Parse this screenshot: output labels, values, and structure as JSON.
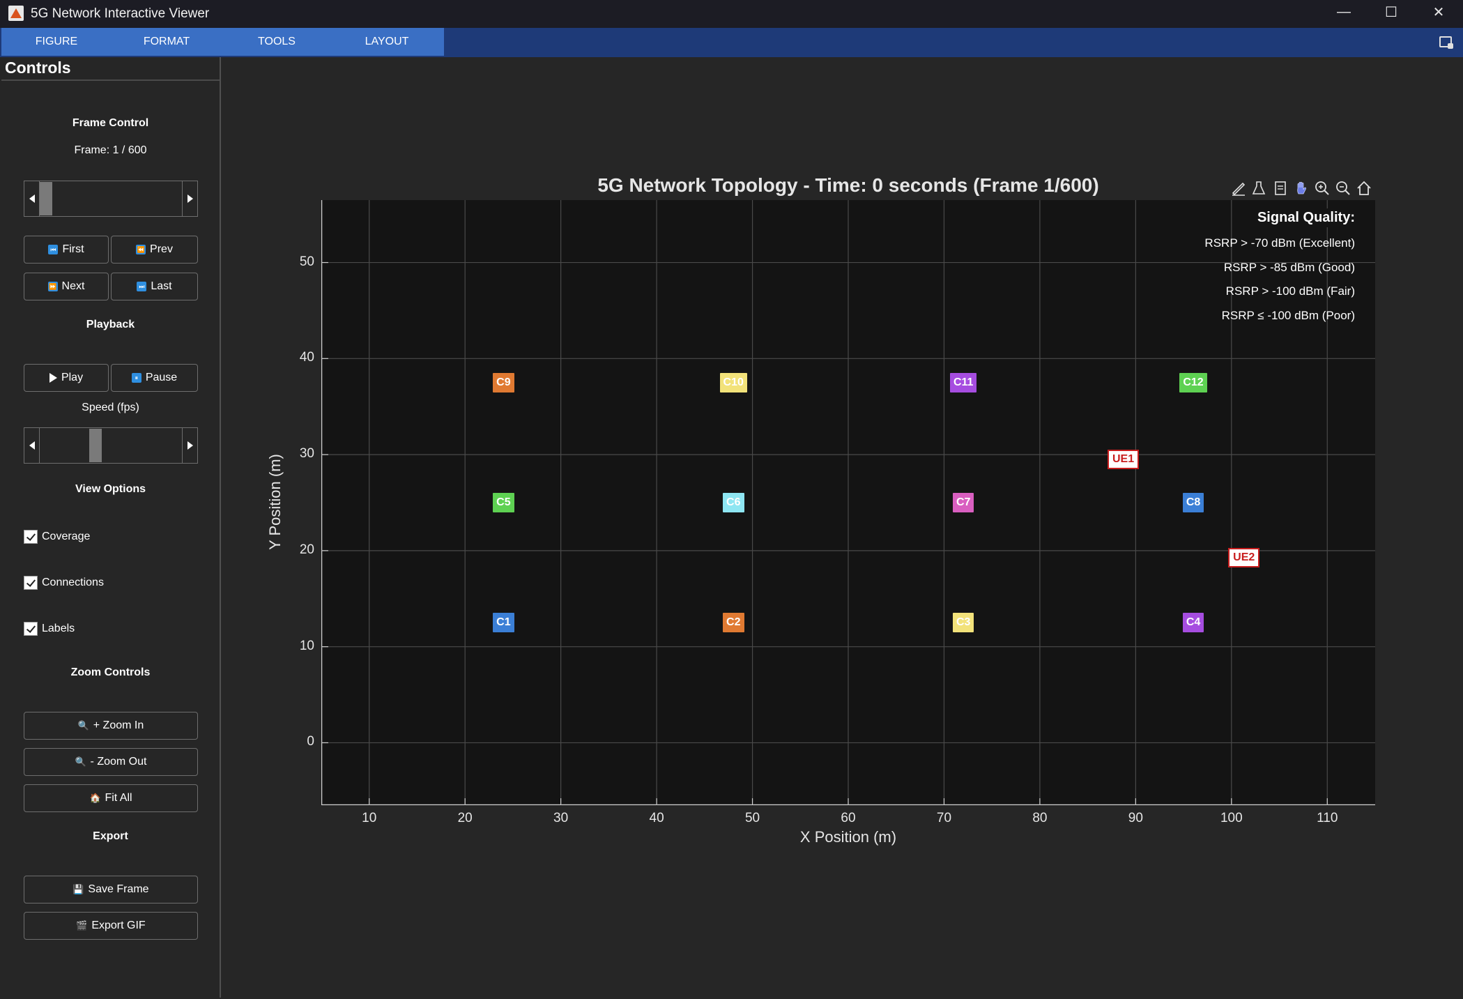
{
  "window": {
    "title": "5G Network Interactive Viewer",
    "minimize": "—",
    "maximize": "☐",
    "close": "✕"
  },
  "toolstrip": {
    "tabs": [
      "FIGURE",
      "FORMAT",
      "TOOLS",
      "LAYOUT"
    ]
  },
  "controls": {
    "title": "Controls",
    "frame_control": {
      "heading": "Frame Control",
      "frame_text": "Frame: 1 / 600",
      "frame_slider_value": 1,
      "frame_slider_max": 600,
      "first": "First",
      "prev": "Prev",
      "next": "Next",
      "last": "Last"
    },
    "playback": {
      "heading": "Playback",
      "play": "Play",
      "pause": "Pause",
      "speed_label": "Speed (fps)",
      "speed_fraction": 0.38
    },
    "view_options": {
      "heading": "View Options",
      "coverage": "Coverage",
      "coverage_checked": true,
      "connections": "Connections",
      "connections_checked": true,
      "labels": "Labels",
      "labels_checked": true
    },
    "zoom": {
      "heading": "Zoom Controls",
      "zoom_in": "+ Zoom In",
      "zoom_out": "- Zoom Out",
      "fit_all": "Fit All"
    },
    "export": {
      "heading": "Export",
      "save_frame": "Save Frame",
      "export_gif": "Export GIF"
    }
  },
  "chart_data": {
    "type": "scatter",
    "title": "5G Network Topology - Time: 0 seconds (Frame 1/600)",
    "xlabel": "X Position (m)",
    "ylabel": "Y Position (m)",
    "xlim": [
      5,
      115
    ],
    "ylim": [
      -6.5,
      56.5
    ],
    "xticks": [
      10,
      20,
      30,
      40,
      50,
      60,
      70,
      80,
      90,
      100,
      110
    ],
    "yticks": [
      0,
      10,
      20,
      30,
      40,
      50
    ],
    "grid": true,
    "legend": {
      "title": "Signal Quality:",
      "placement": "top-right",
      "items": [
        "RSRP > -70 dBm (Excellent)",
        "RSRP > -85 dBm (Good)",
        "RSRP > -100 dBm (Fair)",
        "RSRP ≤ -100 dBm (Poor)"
      ]
    },
    "cells": [
      {
        "label": "C1",
        "x": 24,
        "y": 12.5,
        "color": "#3b7fd6"
      },
      {
        "label": "C2",
        "x": 48,
        "y": 12.5,
        "color": "#e07a32"
      },
      {
        "label": "C3",
        "x": 72,
        "y": 12.5,
        "color": "#f2e27a"
      },
      {
        "label": "C4",
        "x": 96,
        "y": 12.5,
        "color": "#a64de0"
      },
      {
        "label": "C5",
        "x": 24,
        "y": 25,
        "color": "#5ed152"
      },
      {
        "label": "C6",
        "x": 48,
        "y": 25,
        "color": "#8ee6f2"
      },
      {
        "label": "C7",
        "x": 72,
        "y": 25,
        "color": "#d95fc0"
      },
      {
        "label": "C8",
        "x": 96,
        "y": 25,
        "color": "#3b7fd6"
      },
      {
        "label": "C9",
        "x": 24,
        "y": 37.5,
        "color": "#e07a32"
      },
      {
        "label": "C10",
        "x": 48,
        "y": 37.5,
        "color": "#f2e27a"
      },
      {
        "label": "C11",
        "x": 72,
        "y": 37.5,
        "color": "#a64de0"
      },
      {
        "label": "C12",
        "x": 96,
        "y": 37.5,
        "color": "#5ed152"
      }
    ],
    "users": [
      {
        "label": "UE1",
        "x": 88.7,
        "y": 29.5
      },
      {
        "label": "UE2",
        "x": 101.3,
        "y": 19.3
      }
    ]
  }
}
